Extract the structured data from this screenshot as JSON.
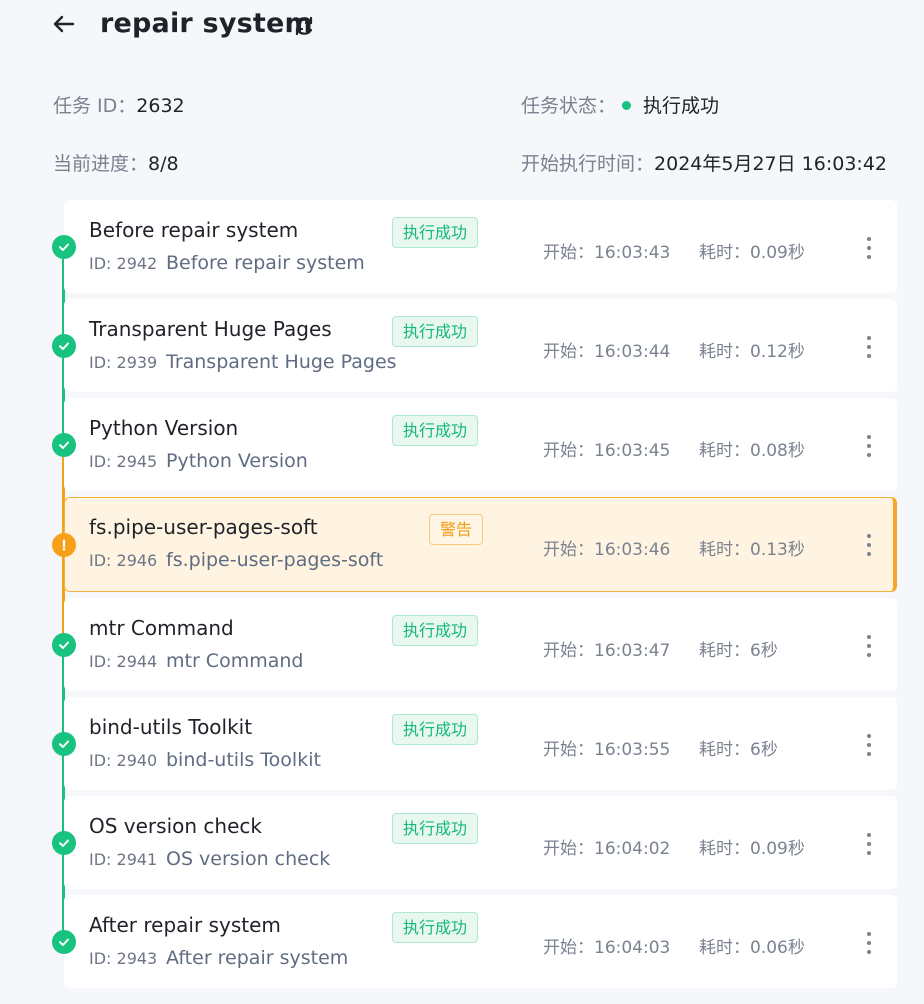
{
  "header": {
    "title": "repair system"
  },
  "info": {
    "task_id_label": "任务 ID：",
    "task_id": "2632",
    "status_label": "任务状态：",
    "status_value": "执行成功",
    "progress_label": "当前进度：",
    "progress_value": "8/8",
    "start_label": "开始执行时间：",
    "start_value": "2024年5月27日 16:03:42"
  },
  "colors": {
    "success": "#18c27f",
    "warning": "#f7a11a"
  },
  "steps": [
    {
      "name": "Before repair system",
      "id": "ID: 2942",
      "desc": "Before repair system",
      "status": "执行成功",
      "kind": "ok",
      "start": "开始：16:03:43",
      "duration": "耗时：0.09秒"
    },
    {
      "name": "Transparent Huge Pages",
      "id": "ID: 2939",
      "desc": "Transparent Huge Pages",
      "status": "执行成功",
      "kind": "ok",
      "start": "开始：16:03:44",
      "duration": "耗时：0.12秒"
    },
    {
      "name": "Python Version",
      "id": "ID: 2945",
      "desc": "Python Version",
      "status": "执行成功",
      "kind": "ok",
      "start": "开始：16:03:45",
      "duration": "耗时：0.08秒"
    },
    {
      "name": "fs.pipe-user-pages-soft",
      "id": "ID: 2946",
      "desc": "fs.pipe-user-pages-soft",
      "status": "警告",
      "kind": "warn",
      "start": "开始：16:03:46",
      "duration": "耗时：0.13秒"
    },
    {
      "name": "mtr Command",
      "id": "ID: 2944",
      "desc": "mtr Command",
      "status": "执行成功",
      "kind": "ok",
      "start": "开始：16:03:47",
      "duration": "耗时：6秒"
    },
    {
      "name": "bind-utils Toolkit",
      "id": "ID: 2940",
      "desc": "bind-utils Toolkit",
      "status": "执行成功",
      "kind": "ok",
      "start": "开始：16:03:55",
      "duration": "耗时：6秒"
    },
    {
      "name": "OS version check",
      "id": "ID: 2941",
      "desc": "OS version check",
      "status": "执行成功",
      "kind": "ok",
      "start": "开始：16:04:02",
      "duration": "耗时：0.09秒"
    },
    {
      "name": "After repair system",
      "id": "ID: 2943",
      "desc": "After repair system",
      "status": "执行成功",
      "kind": "ok",
      "start": "开始：16:04:03",
      "duration": "耗时：0.06秒"
    }
  ],
  "icons": {
    "back": "arrow-left-icon",
    "refresh": "refresh-icon",
    "more": "more-vertical-icon",
    "ok": "check-icon",
    "warn": "exclamation-icon"
  }
}
